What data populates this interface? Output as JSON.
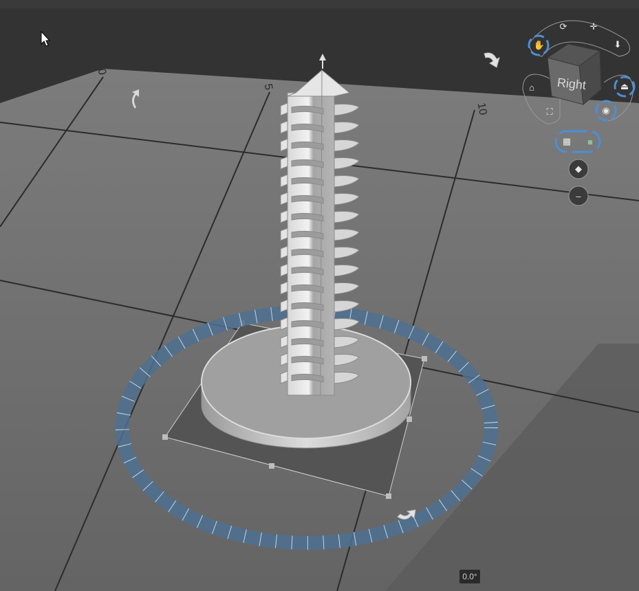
{
  "viewport": {
    "grid_labels": [
      "0",
      "5",
      "10"
    ],
    "rotation_readout": "0.0°",
    "view_cube_face": "Right"
  },
  "nav_widget": {
    "icons": [
      "pan-hand-icon",
      "orbit-icon",
      "move-icon",
      "down-arrow-icon",
      "home-icon",
      "fit-view-icon",
      "perspective-icon",
      "ortho-icon",
      "grid-toggle-icon",
      "solid-view-icon",
      "shading-icon",
      "minus-icon"
    ]
  },
  "colors": {
    "background": "#333333",
    "floor": "#6e6e6e",
    "floor_far": "#7a7a7a",
    "gridline": "#2c2c2c",
    "model": "#c8c8c8",
    "model_edge": "#8a8a8a",
    "rotation_ring": "#4d7190",
    "selection_box": "#545454",
    "control_accent": "#4a90d9"
  }
}
